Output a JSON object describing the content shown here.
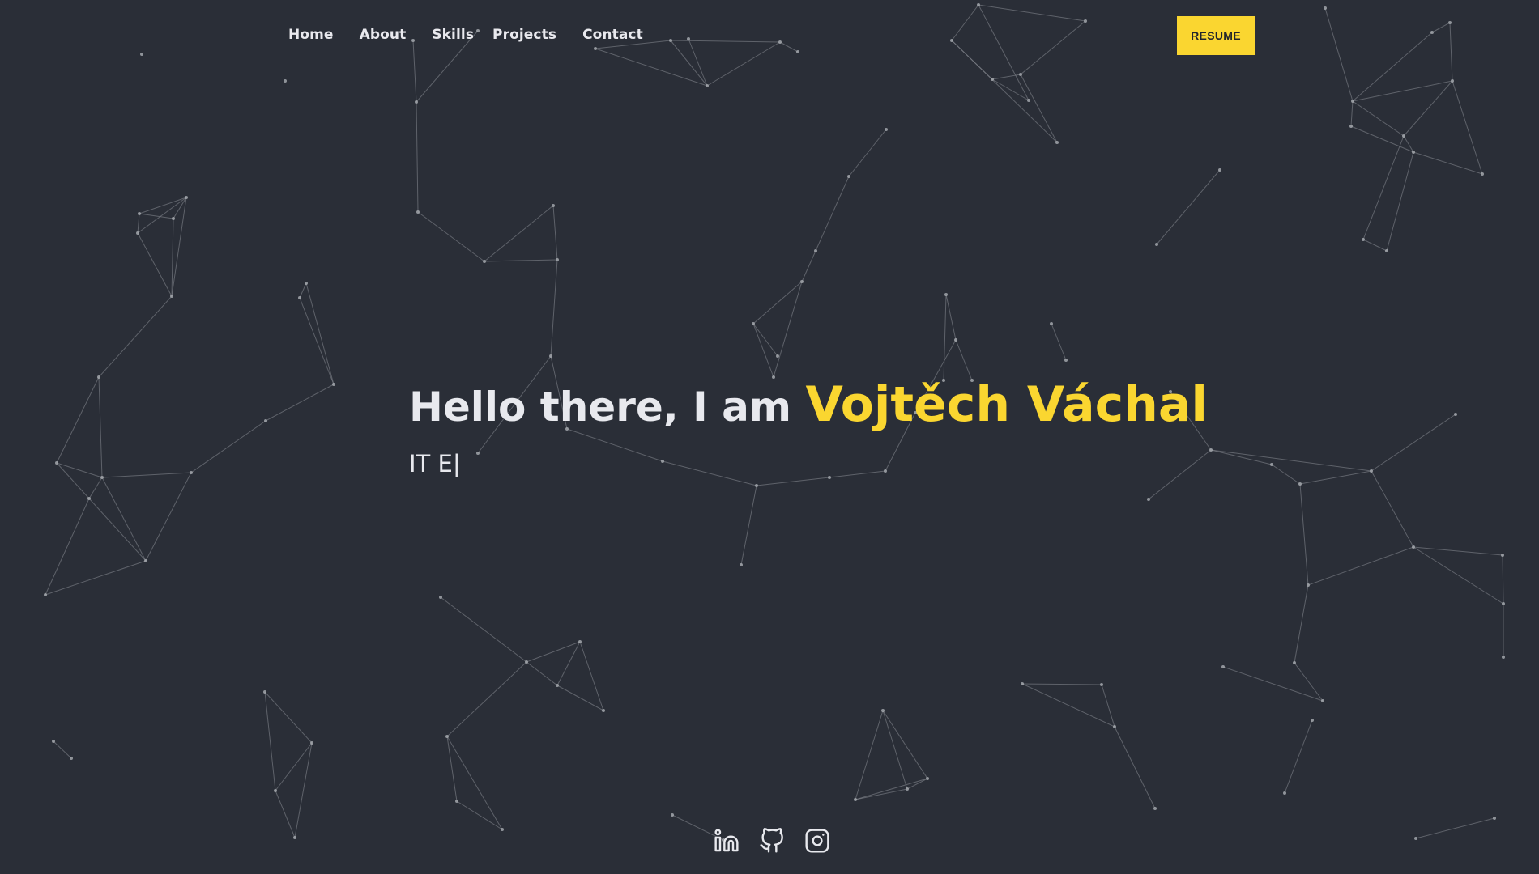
{
  "nav": {
    "items": [
      {
        "label": "Home"
      },
      {
        "label": "About"
      },
      {
        "label": "Skills"
      },
      {
        "label": "Projects"
      },
      {
        "label": "Contact"
      }
    ],
    "resume_label": "RESUME"
  },
  "hero": {
    "greeting": "Hello there, I am ",
    "name": "Vojtěch Váchal",
    "subtitle": "IT E",
    "cursor": "|"
  },
  "socials": [
    {
      "icon": "linkedin-icon"
    },
    {
      "icon": "github-icon"
    },
    {
      "icon": "instagram-icon"
    }
  ],
  "colors": {
    "background": "#2a2e37",
    "accent": "#fad630",
    "text": "#e8e9ee",
    "particles": "#8a8d94"
  }
}
